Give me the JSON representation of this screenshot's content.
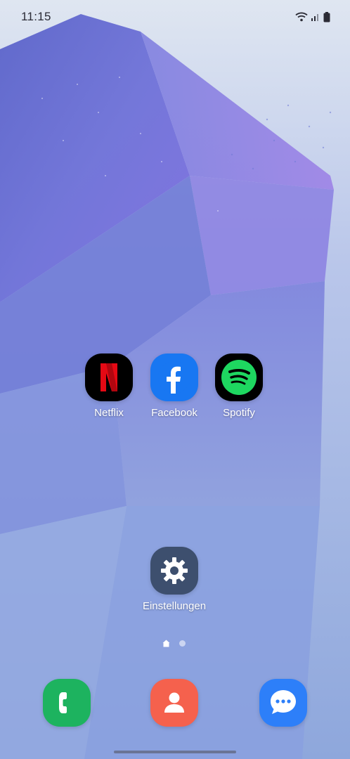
{
  "status_bar": {
    "time": "11:15",
    "icons": [
      "wifi-icon",
      "signal-icon",
      "battery-icon"
    ]
  },
  "home_screen": {
    "apps": [
      {
        "label": "Netflix",
        "icon": "netflix-icon",
        "color": "#000000",
        "accent": "#e50914"
      },
      {
        "label": "Facebook",
        "icon": "facebook-icon",
        "color": "#1877f2"
      },
      {
        "label": "Spotify",
        "icon": "spotify-icon",
        "color": "#000000",
        "accent": "#1ed760"
      },
      {
        "label": "Einstellungen",
        "icon": "gear-icon",
        "color": "#3d4f6e"
      }
    ],
    "page_indicator": {
      "pages": 2,
      "current": 1
    }
  },
  "dock": {
    "apps": [
      {
        "icon": "phone-icon",
        "color": "#1db35f"
      },
      {
        "icon": "contacts-icon",
        "color": "#f5614d"
      },
      {
        "icon": "messages-icon",
        "color": "#2d7ff9"
      }
    ]
  }
}
